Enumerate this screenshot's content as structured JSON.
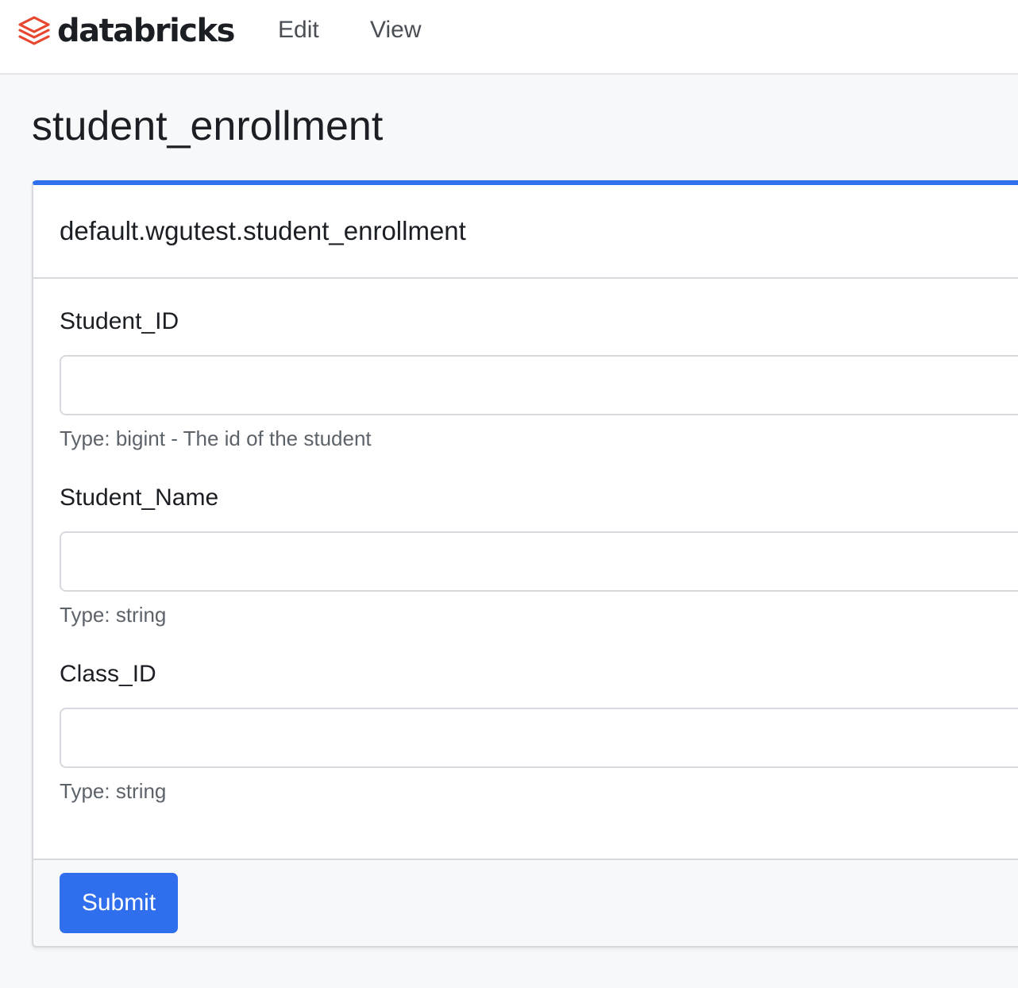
{
  "app": {
    "logo_text": "databricks",
    "logo_icon": "databricks-stack-icon",
    "brand_color": "#e8472f"
  },
  "menu": {
    "items": [
      {
        "label": "Edit"
      },
      {
        "label": "View"
      }
    ]
  },
  "page": {
    "title": "student_enrollment"
  },
  "form": {
    "table_name": "default.wgutest.student_enrollment",
    "accent_color": "#2f6fed",
    "fields": [
      {
        "label": "Student_ID",
        "value": "",
        "help": "Type: bigint - The id of the student"
      },
      {
        "label": "Student_Name",
        "value": "",
        "help": "Type: string"
      },
      {
        "label": "Class_ID",
        "value": "",
        "help": "Type: string"
      }
    ],
    "submit_label": "Submit"
  }
}
